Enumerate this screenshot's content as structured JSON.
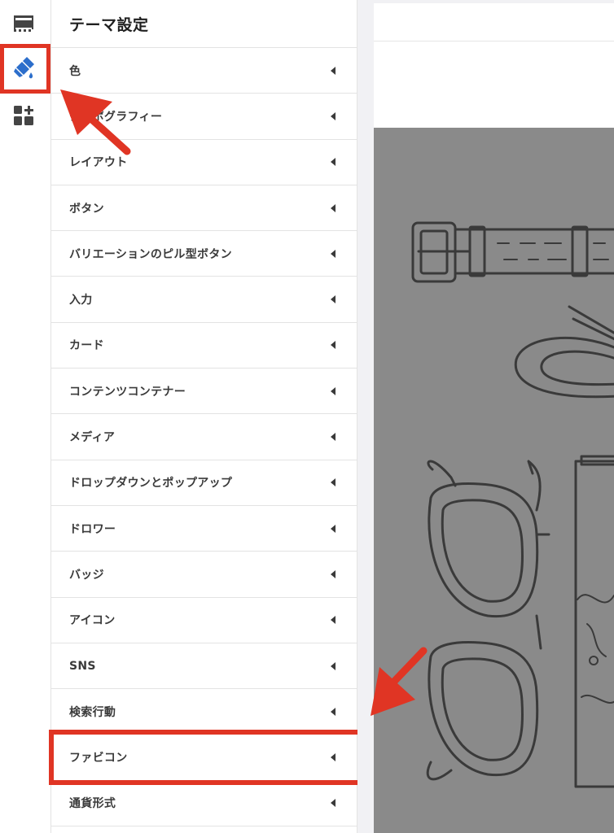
{
  "rail": {
    "items": [
      {
        "icon": "sections-icon"
      },
      {
        "icon": "theme-brush-icon",
        "active": true
      },
      {
        "icon": "apps-add-icon"
      }
    ]
  },
  "panel": {
    "title": "テーマ設定",
    "items": [
      {
        "label": "色"
      },
      {
        "label": "タイポグラフィー"
      },
      {
        "label": "レイアウト"
      },
      {
        "label": "ボタン"
      },
      {
        "label": "バリエーションのピル型ボタン"
      },
      {
        "label": "入力"
      },
      {
        "label": "カード"
      },
      {
        "label": "コンテンツコンテナー"
      },
      {
        "label": "メディア"
      },
      {
        "label": "ドロップダウンとポップアップ"
      },
      {
        "label": "ドロワー"
      },
      {
        "label": "バッジ"
      },
      {
        "label": "アイコン"
      },
      {
        "label": "SNS"
      },
      {
        "label": "検索行動"
      },
      {
        "label": "ファビコン"
      },
      {
        "label": "通貨形式"
      }
    ]
  },
  "colors": {
    "highlight": "#e03524",
    "accent": "#2c6ecb",
    "hero_bg": "#8a8a8a"
  }
}
